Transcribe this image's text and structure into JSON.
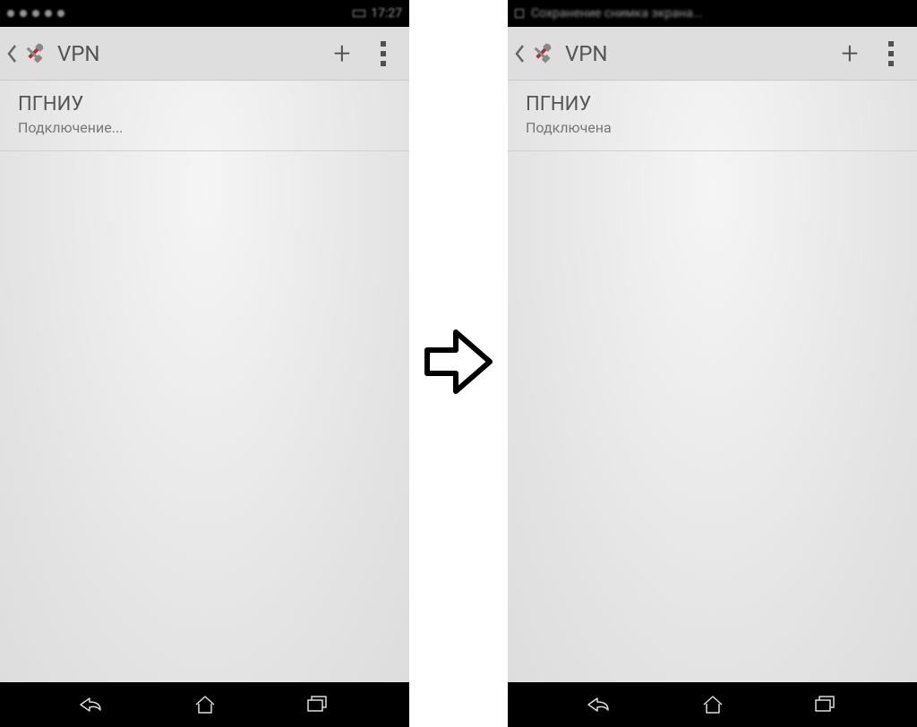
{
  "left": {
    "statusbar": {
      "time": "17:27"
    },
    "actionbar": {
      "title": "VPN"
    },
    "list": [
      {
        "title": "ПГНИУ",
        "subtitle": "Подключение..."
      }
    ]
  },
  "right": {
    "statusbar": {
      "notification": "Сохранение снимка экрана..."
    },
    "actionbar": {
      "title": "VPN"
    },
    "list": [
      {
        "title": "ПГНИУ",
        "subtitle": "Подключена"
      }
    ]
  }
}
